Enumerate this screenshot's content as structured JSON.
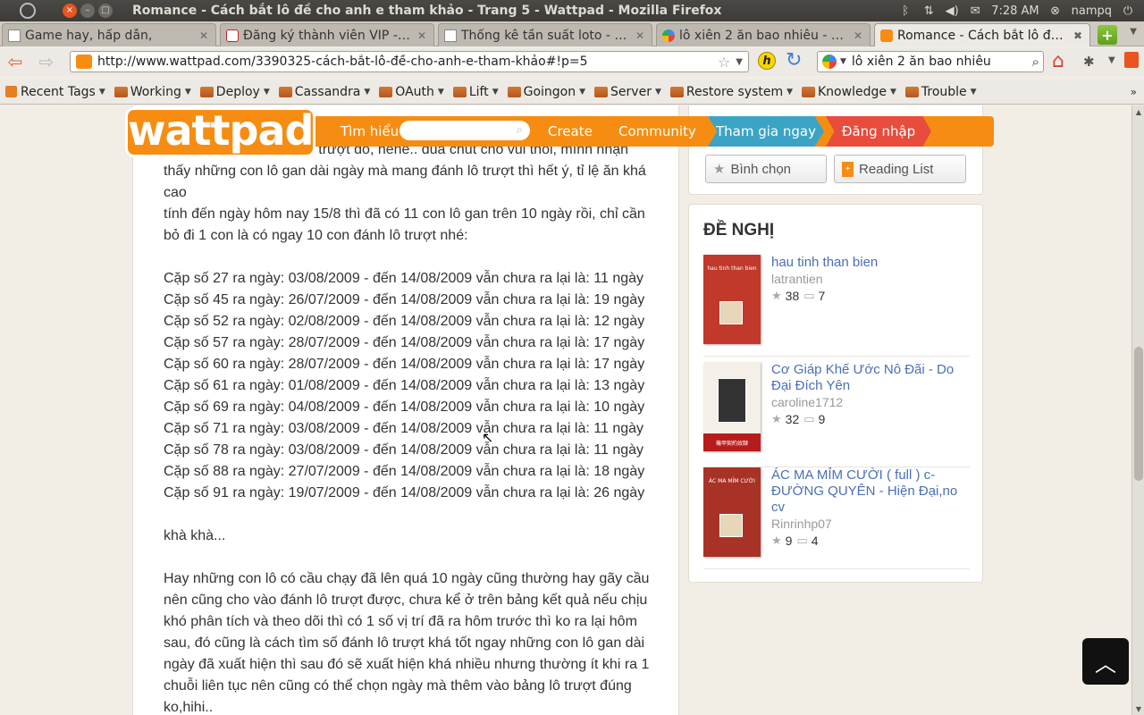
{
  "panel": {
    "title": "Romance - Cách bắt lô đề cho anh e tham khảo - Trang 5 - Wattpad - Mozilla Firefox",
    "time": "7:28 AM",
    "user": "nampq"
  },
  "tabs": [
    {
      "label": "Game hay, hấp dẫn,"
    },
    {
      "label": "Đăng ký thành viên VIP - ke..."
    },
    {
      "label": "Thống kê tần suất loto - Xổ..."
    },
    {
      "label": "lô xiên 2 ăn bao nhiêu - Goo..."
    },
    {
      "label": "Romance - Cách bắt lô đề c..."
    }
  ],
  "nav": {
    "url": "http://www.wattpad.com/3390325-cách-bắt-lô-đề-cho-anh-e-tham-khảo#!p=5",
    "search_value": "lô xiên 2 ăn bao nhiêu",
    "h_label": "h"
  },
  "bookmarks": [
    {
      "label": "Recent Tags",
      "type": "rss"
    },
    {
      "label": "Working",
      "type": "folder"
    },
    {
      "label": "Deploy",
      "type": "folder"
    },
    {
      "label": "Cassandra",
      "type": "folder"
    },
    {
      "label": "OAuth",
      "type": "folder"
    },
    {
      "label": "Lift",
      "type": "folder"
    },
    {
      "label": "Goingon",
      "type": "folder"
    },
    {
      "label": "Server",
      "type": "folder"
    },
    {
      "label": "Restore system",
      "type": "folder"
    },
    {
      "label": "Knowledge",
      "type": "folder"
    },
    {
      "label": "Trouble",
      "type": "folder"
    }
  ],
  "wattpad": {
    "logo": "wattpad",
    "nav_discover": "Tìm hiểu",
    "nav_create": "Create",
    "nav_community": "Community",
    "join": "Tham gia ngay",
    "login": "Đăng nhập"
  },
  "article": {
    "paragraphs": [
      "Vậy đó là cơ để đánh lô trượt đó, hehe.. đùa chút cho vui thôi, mình nhận thấy những con lô gan dài ngày mà mang đánh lô trượt thì hết ý, tỉ lệ ăn khá cao",
      "tính đến ngày hôm nay 15/8 thì đã có 11 con lô gan trên 10 ngày rồi, chỉ cần bỏ đi 1 con là có ngay 10 con đánh lô trượt nhé:",
      "",
      "Cặp số 27 ra ngày: 03/08/2009 - đến 14/08/2009 vẫn chưa ra lại là: 11 ngày",
      "Cặp số 45 ra ngày: 26/07/2009 - đến 14/08/2009 vẫn chưa ra lại là: 19 ngày",
      "Cặp số 52 ra ngày: 02/08/2009 - đến 14/08/2009 vẫn chưa ra lại là: 12 ngày",
      "Cặp số 57 ra ngày: 28/07/2009 - đến 14/08/2009 vẫn chưa ra lại là: 17 ngày",
      "Cặp số 60 ra ngày: 28/07/2009 - đến 14/08/2009 vẫn chưa ra lại là: 17 ngày",
      "Cặp số 61 ra ngày: 01/08/2009 - đến 14/08/2009 vẫn chưa ra lại là: 13 ngày",
      "Cặp số 69 ra ngày: 04/08/2009 - đến 14/08/2009 vẫn chưa ra lại là: 10 ngày",
      "Cặp số 71 ra ngày: 03/08/2009 - đến 14/08/2009 vẫn chưa ra lại là: 11 ngày",
      "Cặp số 78 ra ngày: 03/08/2009 - đến 14/08/2009 vẫn chưa ra lại là: 11 ngày",
      "Cặp số 88 ra ngày: 27/07/2009 - đến 14/08/2009 vẫn chưa ra lại là: 18 ngày",
      "Cặp số 91 ra ngày: 19/07/2009 - đến 14/08/2009 vẫn chưa ra lại là: 26 ngày",
      "",
      "khà khà...",
      "",
      "Hay những con lô có cầu chạy đã lên quá 10 ngày cũng thường hay gãy cầu nên cũng cho vào đánh lô trượt được, chưa kể ở trên bảng kết quả nếu chịu khó phân tích và theo dõi thì có 1 số vị trí đã ra hôm trước thì ko ra lại hôm sau, đó cũng là cách tìm số đánh lô trượt khá tốt ngay những con lô gan dài ngày đã xuất hiện thì sau đó sẽ xuất hiện khá nhiều nhưng thường ít khi ra 1 chuỗi liên tục nên cũng có thể chọn ngày mà thêm vào bảng lô trượt đúng ko,hihi.."
    ]
  },
  "sidebar": {
    "vote_label": "Bình chọn",
    "reading_list_label": "Reading List",
    "recommend_title": "ĐỀ NGHỊ",
    "recommendations": [
      {
        "title": "hau tinh than bien",
        "author": "latrantien",
        "votes": "38",
        "comments": "7",
        "cover_text": "hau tinh than bien"
      },
      {
        "title": "Cơ Giáp Khế Ước Nô Đãi - Do Đại Đích Yên",
        "author": "caroline1712",
        "votes": "32",
        "comments": "9",
        "cover_text": "機甲契約奴隸"
      },
      {
        "title": "ÁC MA MỈM CƯỜI ( full ) c-ĐƯỜNG QUYÊN - Hiện Đại,no cv",
        "author": "Rinrinhp07",
        "votes": "9",
        "comments": "4",
        "cover_text": "ÁC MA MỈM CƯỜI"
      }
    ]
  },
  "colors": {
    "brand": "#f68d12",
    "join": "#3ba4c5",
    "login": "#e84c3d",
    "link": "#4a6fb5"
  }
}
